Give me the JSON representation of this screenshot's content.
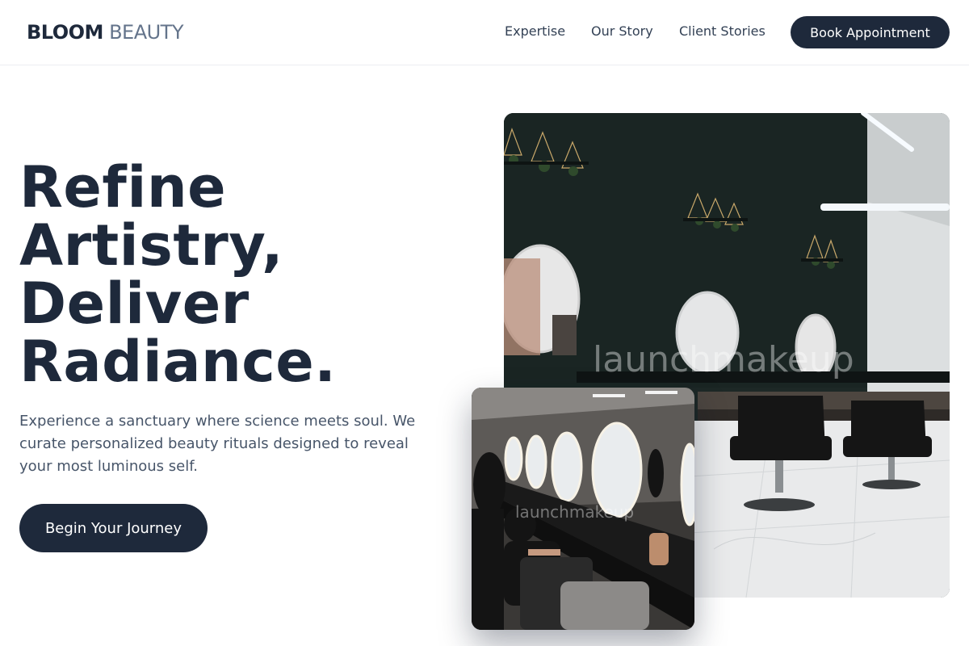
{
  "header": {
    "logo_bold": "BLOOM",
    "logo_light": "BEAUTY",
    "nav": [
      "Expertise",
      "Our Story",
      "Client Stories"
    ],
    "book_label": "Book Appointment"
  },
  "hero": {
    "headline_lines": [
      "Refine",
      "Artistry,",
      "Deliver",
      "Radiance."
    ],
    "lead": "Experience a sanctuary where science meets soul. We curate personalized beauty rituals designed to reveal your most luminous self.",
    "cta_label": "Begin Your Journey"
  },
  "images": {
    "main_watermark": "launchmakeup",
    "inset_watermark": "launchmakeup"
  },
  "colors": {
    "primary": "#1e293b",
    "muted_text": "#475569",
    "logo_light": "#64748b",
    "background": "#ffffff"
  }
}
